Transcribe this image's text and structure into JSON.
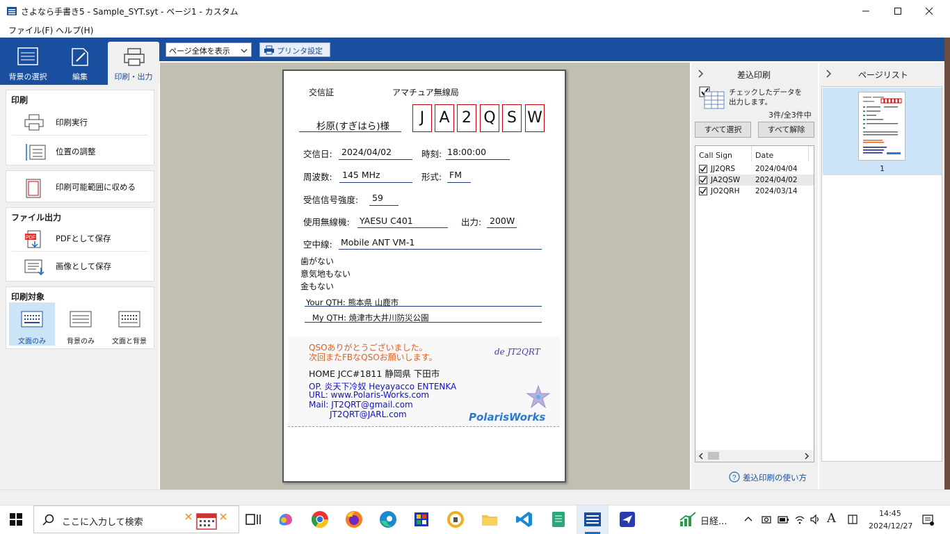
{
  "window": {
    "title": "さよなら手書き5 - Sample_SYT.syt - ページ1 - カスタム"
  },
  "menu": [
    "ファイル(F)",
    "ヘルプ(H)"
  ],
  "ribbon": {
    "tabs": [
      "背景の選択",
      "編集",
      "印刷・出力"
    ],
    "zoom_value": "ページ全体を表示",
    "printer_label": "プリンタ設定"
  },
  "left": {
    "print_title": "印刷",
    "print_exec": "印刷実行",
    "position_adjust": "位置の調整",
    "fit_printable": "印刷可能範囲に収める",
    "file_output_title": "ファイル出力",
    "save_pdf": "PDFとして保存",
    "save_image": "画像として保存",
    "target_title": "印刷対象",
    "targets": [
      "文面のみ",
      "背景のみ",
      "文面と背景"
    ]
  },
  "card": {
    "title_left": "交信証",
    "title_right": "アマチュア無線局",
    "recipient": "杉原(すぎはら)様",
    "callsign_chars": [
      "J",
      "A",
      "2",
      "Q",
      "S",
      "W"
    ],
    "date_label": "交信日:",
    "date": "2024/04/02",
    "time_label": "時刻:",
    "time": "18:00:00",
    "freq_label": "周波数:",
    "freq": "145 MHz",
    "mode_label": "形式:",
    "mode": "FM",
    "rst_label": "受信信号強度:",
    "rst": "59",
    "rig_label": "使用無線機:",
    "rig": "YAESU C401",
    "power_label": "出力:",
    "power": "200W",
    "ant_label": "空中線:",
    "ant": "Mobile ANT VM-1",
    "notes": [
      "歯がない",
      "意気地もない",
      "金もない"
    ],
    "your_qth": "Your QTH: 熊本県 山鹿市",
    "my_qth": "My QTH: 焼津市大井川防災公園",
    "thanks1": "QSOありがとうございました。",
    "thanks2": "次回またFBなQSOお願いします。",
    "de": "de JT2QRT",
    "home": "HOME JCC#1811 静岡県 下田市",
    "op": "OP. 炎天下冷奴  Heyayacco ENTENKA",
    "url": "URL: www.Polaris-Works.com",
    "mail1": "Mail: JT2QRT@gmail.com",
    "mail2": "JT2QRT@JARL.com",
    "logo": "PolarisWorks"
  },
  "merge": {
    "header": "差込印刷",
    "desc1": "チェックしたデータを",
    "desc2": "出力します。",
    "count": "3件/全3件中",
    "select_all": "すべて選択",
    "deselect_all": "すべて解除",
    "col_callsign": "Call Sign",
    "col_date": "Date",
    "rows": [
      {
        "call": "JJ2QRS",
        "date": "2024/04/04"
      },
      {
        "call": "JA2QSW",
        "date": "2024/04/02"
      },
      {
        "call": "JO2QRH",
        "date": "2024/03/14"
      }
    ],
    "help_link": "差込印刷の使い方"
  },
  "pagelist": {
    "header": "ページリスト",
    "page_number": "1"
  },
  "taskbar": {
    "search_placeholder": "ここに入力して検索",
    "stock": "日経...",
    "ime": "A",
    "time": "14:45",
    "date": "2024/12/27"
  },
  "colors": {
    "ribbon": "#1a4fa0",
    "canvas": "#c0bfb2",
    "callsign_border": "#cc0000"
  }
}
